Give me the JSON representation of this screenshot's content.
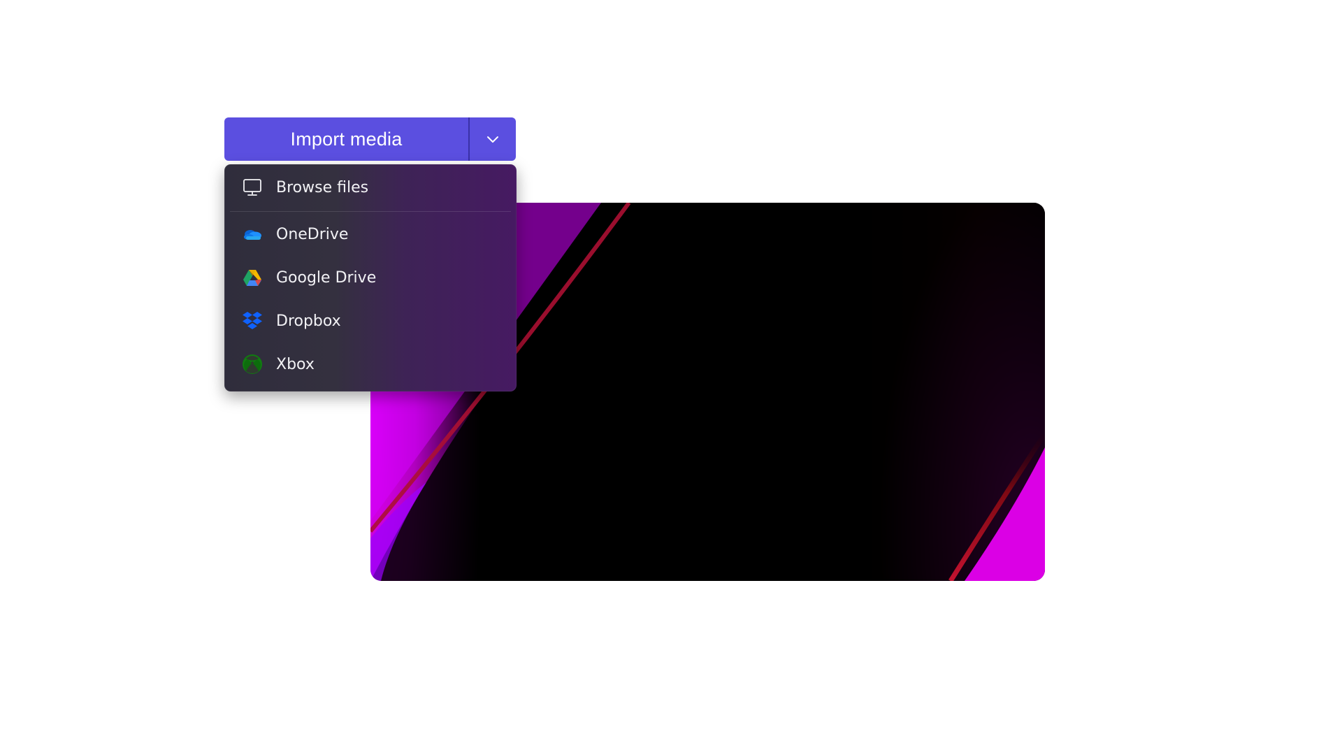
{
  "split_button": {
    "label": "Import media",
    "arrow_icon": "chevron-down-icon",
    "color": "#5b4fe0"
  },
  "menu": {
    "items": [
      {
        "label": "Browse files",
        "icon": "monitor-icon"
      },
      {
        "label": "OneDrive",
        "icon": "onedrive-icon"
      },
      {
        "label": "Google Drive",
        "icon": "google-drive-icon"
      },
      {
        "label": "Dropbox",
        "icon": "dropbox-icon"
      },
      {
        "label": "Xbox",
        "icon": "xbox-icon"
      }
    ]
  },
  "preview": {
    "accent": "#eb00ff"
  }
}
